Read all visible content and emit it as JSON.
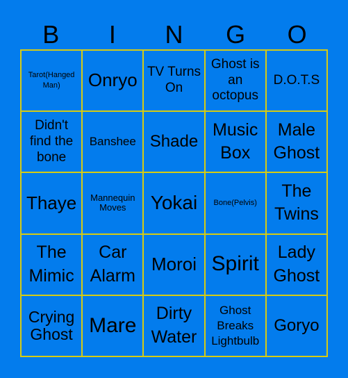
{
  "header": [
    "B",
    "I",
    "N",
    "G",
    "O"
  ],
  "cells": [
    "Tarot(Hanged Man)",
    "Onryo",
    "TV Turns On",
    "Ghost is an octopus",
    "D.O.T.S",
    "Didn't find the bone",
    "Banshee",
    "Shade",
    "Music Box",
    "Male Ghost",
    "Thaye",
    "Mannequin Moves",
    "Yokai",
    "Bone(Pelvis)",
    "The Twins",
    "The Mimic",
    "Car Alarm",
    "Moroi",
    "Spirit",
    "Lady Ghost",
    "Crying Ghost",
    "Mare",
    "Dirty Water",
    "Ghost Breaks Lightbulb",
    "Goryo"
  ],
  "colors": {
    "background": "#037ced",
    "grid_line": "#d6cc13",
    "text": "#000000"
  }
}
